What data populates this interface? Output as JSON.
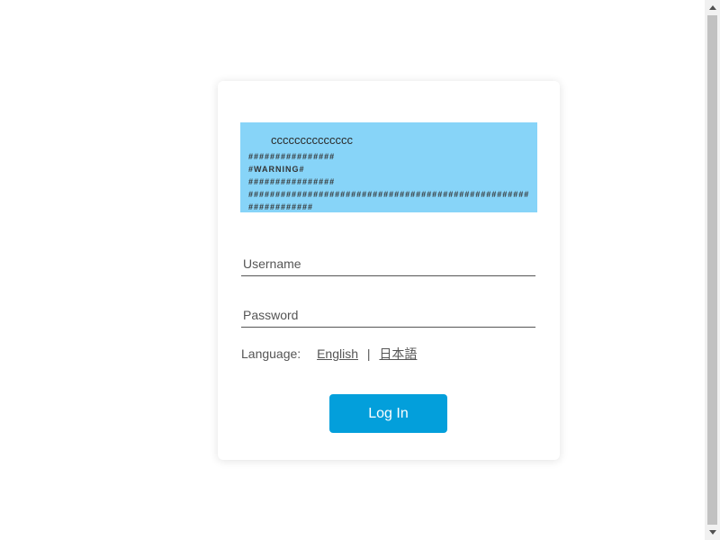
{
  "banner": {
    "title": "cccccccccccccc",
    "lines": [
      "################",
      "#WARNING#",
      "################",
      "####################################################",
      "############"
    ]
  },
  "form": {
    "username_placeholder": "Username",
    "password_placeholder": "Password",
    "language_label": "Language:",
    "language_english": "English",
    "language_separator": "|",
    "language_japanese": "日本語",
    "login_label": "Log In"
  },
  "colors": {
    "banner_bg": "#87d4f8",
    "login_button": "#039fdb"
  }
}
